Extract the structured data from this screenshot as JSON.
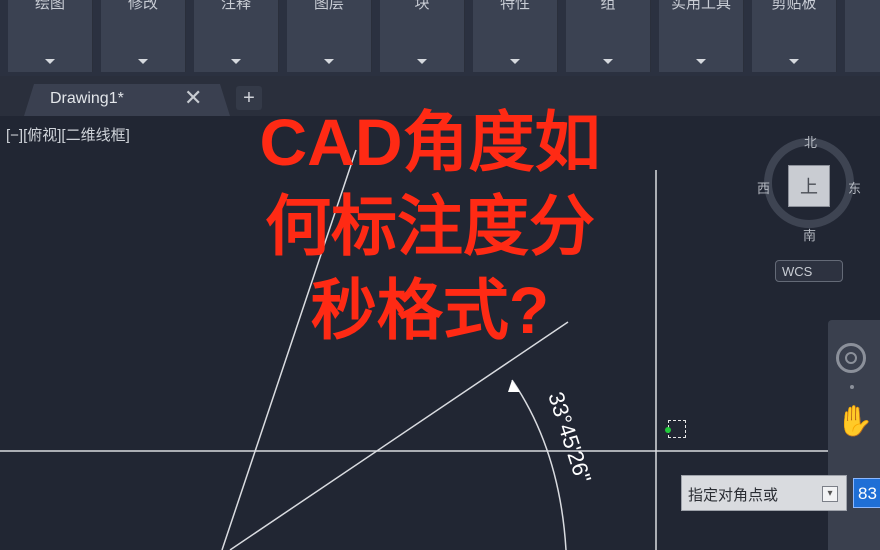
{
  "ribbon": {
    "panels": [
      {
        "label": "绘图"
      },
      {
        "label": "修改"
      },
      {
        "label": "注释"
      },
      {
        "label": "图层"
      },
      {
        "label": "块"
      },
      {
        "label": "特性"
      },
      {
        "label": "组"
      },
      {
        "label": "实用工具"
      },
      {
        "label": "剪贴板"
      }
    ]
  },
  "tabs": {
    "active_title": "Drawing1*",
    "close_glyph": "✕",
    "new_tab_glyph": "+"
  },
  "viewport": {
    "control_label": "[−][俯视][二维线框]"
  },
  "overlay": {
    "line1": "CAD角度如",
    "line2": "何标注度分",
    "line3": "秒格式?"
  },
  "dimension": {
    "angle_text": "33°45'26\""
  },
  "viewcube": {
    "north": "北",
    "south": "南",
    "east": "东",
    "west": "西",
    "face": "上",
    "ucs_menu": "WCS"
  },
  "command": {
    "prompt_text": "指定对角点或",
    "coordinate_value": "83"
  },
  "colors": {
    "headline": "#ff2a14",
    "canvas_bg": "#212633",
    "coord_input_bg": "#1f6fd6"
  }
}
